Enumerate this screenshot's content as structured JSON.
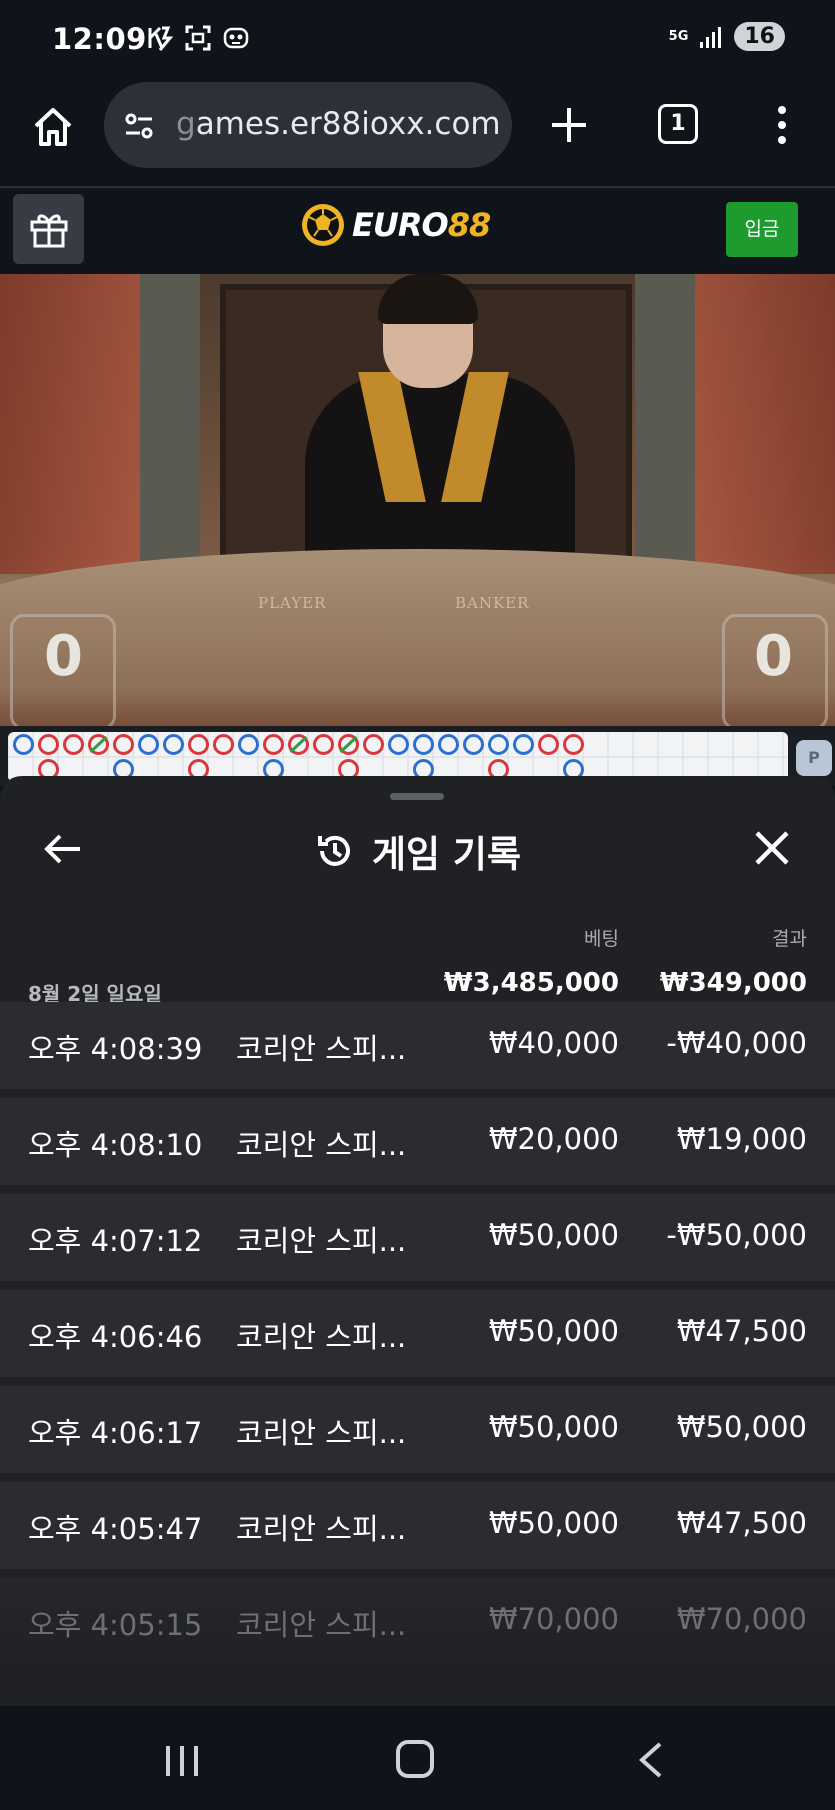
{
  "status_bar": {
    "time": "12:09",
    "network": "5G",
    "battery": "16"
  },
  "browser": {
    "url_prefix": "g",
    "url": "ames.er88ioxx.com",
    "tab_count": "1"
  },
  "site": {
    "logo_text": "EURO",
    "logo_number": "88",
    "deposit_label": "입금"
  },
  "video": {
    "player_label": "PLAYER",
    "banker_label": "BANKER",
    "player_score": "0",
    "banker_score": "0",
    "side_badge": "P"
  },
  "sheet": {
    "title": "게임 기록",
    "col_bet": "베팅",
    "col_result": "결과",
    "date": "8월 2일 일요일",
    "total_bet": "₩3,485,000",
    "total_result": "₩349,000",
    "rows": [
      {
        "time": "오후 4:08:39",
        "game": "코리안 스피...",
        "bet": "₩40,000",
        "result": "-₩40,000"
      },
      {
        "time": "오후 4:08:10",
        "game": "코리안 스피...",
        "bet": "₩20,000",
        "result": "₩19,000"
      },
      {
        "time": "오후 4:07:12",
        "game": "코리안 스피...",
        "bet": "₩50,000",
        "result": "-₩50,000"
      },
      {
        "time": "오후 4:06:46",
        "game": "코리안 스피...",
        "bet": "₩50,000",
        "result": "₩47,500"
      },
      {
        "time": "오후 4:06:17",
        "game": "코리안 스피...",
        "bet": "₩50,000",
        "result": "₩50,000"
      },
      {
        "time": "오후 4:05:47",
        "game": "코리안 스피...",
        "bet": "₩50,000",
        "result": "₩47,500"
      },
      {
        "time": "오후 4:05:15",
        "game": "코리안 스피...",
        "bet": "₩70,000",
        "result": "₩70,000"
      }
    ]
  },
  "colors": {
    "deposit_green": "#1e9b2e",
    "logo_gold": "#f0b323",
    "road_banker": "#d9363e",
    "road_player": "#2b6fd1",
    "road_tie": "#2e9e44"
  }
}
